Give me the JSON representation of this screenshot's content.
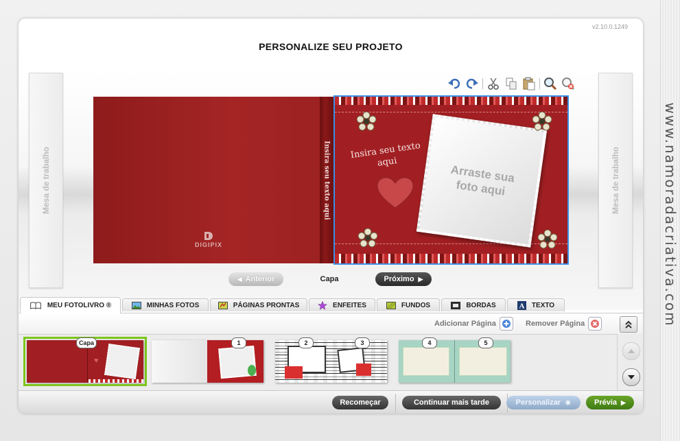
{
  "app": {
    "version": "v2.10.0.1249",
    "title": "PERSONALIZE SEU PROJETO"
  },
  "workspace": {
    "left_panel_label": "Mesa de trabalho",
    "right_panel_label": "Mesa de trabalho"
  },
  "toolbar": {
    "icons": [
      "undo-icon",
      "redo-icon",
      "cut-icon",
      "copy-icon",
      "paste-icon",
      "zoom-in-icon",
      "zoom-reset-icon"
    ]
  },
  "book": {
    "brand": "DIGIPIX",
    "spine_text": "Insira seu texto aqui",
    "cover_text": "Insira seu texto aqui",
    "photo_placeholder": "Arraste sua foto aqui",
    "colors": {
      "cover": "#a11f22",
      "selection": "#3b8fe8"
    }
  },
  "navigation": {
    "prev_label": "Anterior",
    "current_page": "Capa",
    "next_label": "Próximo"
  },
  "tabs": [
    {
      "label": "MEU FOTOLIVRO ®",
      "icon": "book-icon",
      "active": true
    },
    {
      "label": "MINHAS FOTOS",
      "icon": "photos-icon",
      "active": false
    },
    {
      "label": "PÁGINAS PRONTAS",
      "icon": "pages-icon",
      "active": false
    },
    {
      "label": "ENFEITES",
      "icon": "star-icon",
      "active": false
    },
    {
      "label": "FUNDOS",
      "icon": "background-icon",
      "active": false
    },
    {
      "label": "BORDAS",
      "icon": "frame-icon",
      "active": false
    },
    {
      "label": "TEXTO",
      "icon": "text-icon",
      "active": false
    }
  ],
  "pages_actions": {
    "add_label": "Adicionar Página",
    "remove_label": "Remover Página"
  },
  "thumbnails": [
    {
      "badge": "Capa",
      "selected": true
    },
    {
      "badge": "1",
      "selected": false
    },
    {
      "badges": [
        "2",
        "3"
      ],
      "selected": false
    },
    {
      "badges": [
        "4",
        "5"
      ],
      "selected": false
    }
  ],
  "footer": {
    "restart_label": "Recomeçar",
    "continue_later_label": "Continuar mais tarde",
    "customize_label": "Personalizar",
    "preview_label": "Prévia"
  },
  "watermark": "www.namoradacriativa.com"
}
